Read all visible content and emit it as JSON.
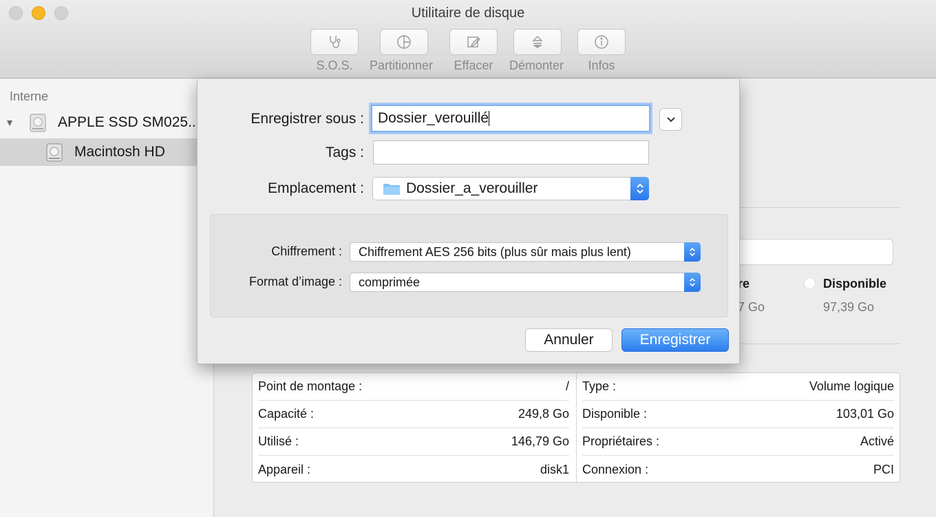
{
  "window": {
    "title": "Utilitaire de disque"
  },
  "toolbar": {
    "items": [
      {
        "label": "S.O.S.",
        "icon": "stethoscope-icon"
      },
      {
        "label": "Partitionner",
        "icon": "pie-chart-icon"
      },
      {
        "label": "Effacer",
        "icon": "pencil-icon"
      },
      {
        "label": "Démonter",
        "icon": "eject-icon"
      },
      {
        "label": "Infos",
        "icon": "info-icon"
      }
    ]
  },
  "sidebar": {
    "section": "Interne",
    "items": [
      {
        "label": "APPLE SSD SM025..",
        "icon": "disk-icon"
      },
      {
        "label": "Macintosh HD",
        "icon": "volume-icon"
      }
    ]
  },
  "dialog": {
    "save_as_label": "Enregistrer sous :",
    "save_as_value": "Dossier_verouillé",
    "tags_label": "Tags :",
    "tags_value": "",
    "location_label": "Emplacement :",
    "location_value": "Dossier_a_verouiller",
    "encryption_label": "Chiffrement :",
    "encryption_value": "Chiffrement AES 256 bits (plus sûr mais plus lent)",
    "format_label": "Format d’image :",
    "format_value": "comprimée",
    "cancel_label": "Annuler",
    "save_label": "Enregistrer"
  },
  "usage": {
    "partial_name": "re",
    "partial_value": "7 Go",
    "available_name": "Disponible",
    "available_value": "97,39 Go"
  },
  "info": {
    "left": [
      {
        "label": "Point de montage :",
        "value": "/"
      },
      {
        "label": "Capacité :",
        "value": "249,8 Go"
      },
      {
        "label": "Utilisé :",
        "value": "146,79 Go"
      },
      {
        "label": "Appareil :",
        "value": "disk1"
      }
    ],
    "right": [
      {
        "label": "Type :",
        "value": "Volume logique"
      },
      {
        "label": "Disponible :",
        "value": "103,01 Go"
      },
      {
        "label": "Propriétaires :",
        "value": "Activé"
      },
      {
        "label": "Connexion :",
        "value": "PCI"
      }
    ]
  },
  "colors": {
    "accent": "#2b7eef",
    "focus_ring": "#a9c9f5",
    "minimize": "#f5b824"
  }
}
